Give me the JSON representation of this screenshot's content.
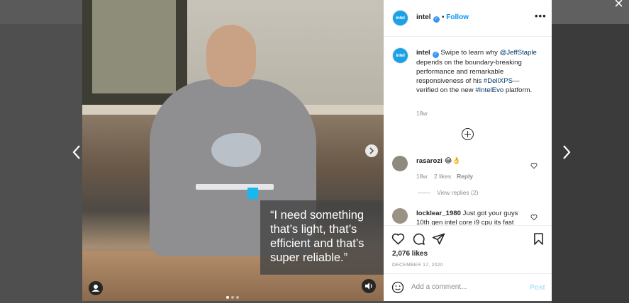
{
  "overlay": {
    "close_icon": "×"
  },
  "media": {
    "quote": "“I need something that’s light, that’s efficient and that’s super reliable.”",
    "carousel": {
      "current": 1,
      "total": 3
    }
  },
  "post": {
    "username": "intel",
    "avatar_text": "intel",
    "follow_label": "Follow",
    "separator": "•",
    "more_label": "•••",
    "caption_user": "intel",
    "caption_pre": " Swipe to learn why ",
    "caption_mention": "@JeffStaple",
    "caption_mid": " depends on the boundary-breaking performance and remarkable responsiveness of his ",
    "caption_tag1": "#DellXPS",
    "caption_mid2": "—verified on the new ",
    "caption_tag2": "#IntelEvo",
    "caption_post": " platform.",
    "caption_age": "18w",
    "likes": "2,076 likes",
    "date": "DECEMBER 17, 2020"
  },
  "comments": [
    {
      "user": "rasarozi",
      "text": "😂👌",
      "age": "18w",
      "likes": "2 likes",
      "reply": "Reply",
      "view_replies": "View replies (2)"
    },
    {
      "user": "locklear_1980",
      "text": "Just got your guys 10th gen intel core i9 cpu its fast"
    }
  ],
  "comment_box": {
    "placeholder": "Add a comment...",
    "post_label": "Post"
  },
  "colors": {
    "accent": "#0095f6",
    "brand": "#1ba1e6",
    "verified": "#3897f0"
  }
}
